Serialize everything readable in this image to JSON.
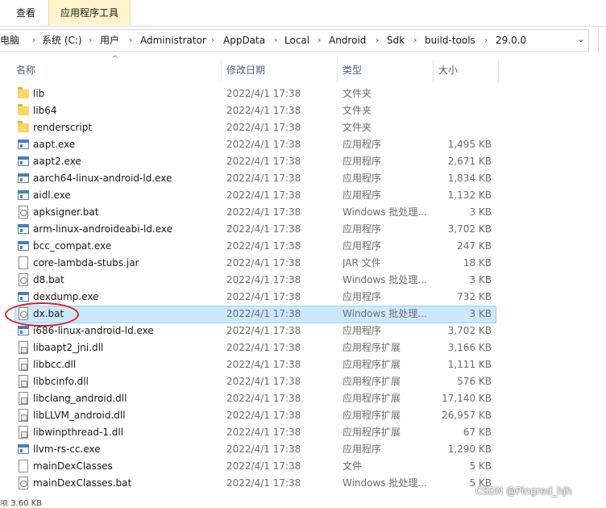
{
  "ribbon": {
    "tabs": [
      {
        "label": "查看"
      },
      {
        "label": "应用程序工具"
      }
    ]
  },
  "address": {
    "crumbs": [
      "电脑",
      "系统 (C:)",
      "用户",
      "Administrator",
      "AppData",
      "Local",
      "Android",
      "Sdk",
      "build-tools",
      "29.0.0"
    ],
    "separator": "›",
    "dropdown_icon": "chevron-down-icon"
  },
  "columns": {
    "name": "名称",
    "date": "修改日期",
    "type": "类型",
    "size": "大小"
  },
  "files": [
    {
      "name": "lib",
      "date": "2022/4/1 17:38",
      "type": "文件夹",
      "size": "",
      "icon": "folder-icon"
    },
    {
      "name": "lib64",
      "date": "2022/4/1 17:38",
      "type": "文件夹",
      "size": "",
      "icon": "folder-icon"
    },
    {
      "name": "renderscript",
      "date": "2022/4/1 17:38",
      "type": "文件夹",
      "size": "",
      "icon": "folder-icon"
    },
    {
      "name": "aapt.exe",
      "date": "2022/4/1 17:38",
      "type": "应用程序",
      "size": "1,495 KB",
      "icon": "exe-icon"
    },
    {
      "name": "aapt2.exe",
      "date": "2022/4/1 17:38",
      "type": "应用程序",
      "size": "2,671 KB",
      "icon": "exe-icon"
    },
    {
      "name": "aarch64-linux-android-ld.exe",
      "date": "2022/4/1 17:38",
      "type": "应用程序",
      "size": "1,834 KB",
      "icon": "exe-icon"
    },
    {
      "name": "aidl.exe",
      "date": "2022/4/1 17:38",
      "type": "应用程序",
      "size": "1,132 KB",
      "icon": "exe-icon"
    },
    {
      "name": "apksigner.bat",
      "date": "2022/4/1 17:38",
      "type": "Windows 批处理...",
      "size": "3 KB",
      "icon": "bat-icon"
    },
    {
      "name": "arm-linux-androideabi-ld.exe",
      "date": "2022/4/1 17:38",
      "type": "应用程序",
      "size": "3,702 KB",
      "icon": "exe-icon"
    },
    {
      "name": "bcc_compat.exe",
      "date": "2022/4/1 17:38",
      "type": "应用程序",
      "size": "247 KB",
      "icon": "exe-icon"
    },
    {
      "name": "core-lambda-stubs.jar",
      "date": "2022/4/1 17:38",
      "type": "JAR 文件",
      "size": "18 KB",
      "icon": "file-icon"
    },
    {
      "name": "d8.bat",
      "date": "2022/4/1 17:38",
      "type": "Windows 批处理...",
      "size": "3 KB",
      "icon": "bat-icon"
    },
    {
      "name": "dexdump.exe",
      "date": "2022/4/1 17:38",
      "type": "应用程序",
      "size": "732 KB",
      "icon": "exe-icon"
    },
    {
      "name": "dx.bat",
      "date": "2022/4/1 17:38",
      "type": "Windows 批处理...",
      "size": "3 KB",
      "icon": "bat-icon",
      "selected": true
    },
    {
      "name": "i686-linux-android-ld.exe",
      "date": "2022/4/1 17:38",
      "type": "应用程序",
      "size": "3,702 KB",
      "icon": "exe-icon"
    },
    {
      "name": "libaapt2_jni.dll",
      "date": "2022/4/1 17:38",
      "type": "应用程序扩展",
      "size": "3,166 KB",
      "icon": "dll-icon"
    },
    {
      "name": "libbcc.dll",
      "date": "2022/4/1 17:38",
      "type": "应用程序扩展",
      "size": "1,111 KB",
      "icon": "dll-icon"
    },
    {
      "name": "libbcinfo.dll",
      "date": "2022/4/1 17:38",
      "type": "应用程序扩展",
      "size": "576 KB",
      "icon": "dll-icon"
    },
    {
      "name": "libclang_android.dll",
      "date": "2022/4/1 17:38",
      "type": "应用程序扩展",
      "size": "17,140 KB",
      "icon": "dll-icon"
    },
    {
      "name": "libLLVM_android.dll",
      "date": "2022/4/1 17:38",
      "type": "应用程序扩展",
      "size": "26,957 KB",
      "icon": "dll-icon"
    },
    {
      "name": "libwinpthread-1.dll",
      "date": "2022/4/1 17:38",
      "type": "应用程序扩展",
      "size": "67 KB",
      "icon": "dll-icon"
    },
    {
      "name": "llvm-rs-cc.exe",
      "date": "2022/4/1 17:38",
      "type": "应用程序",
      "size": "1,290 KB",
      "icon": "exe-icon"
    },
    {
      "name": "mainDexClasses",
      "date": "2022/4/1 17:38",
      "type": "文件",
      "size": "5 KB",
      "icon": "file-icon"
    },
    {
      "name": "mainDexClasses.bat",
      "date": "2022/4/1 17:38",
      "type": "Windows 批处理...",
      "size": "5 KB",
      "icon": "bat-icon"
    }
  ],
  "status": {
    "text": "项 3.60 KB"
  },
  "watermark": "CSDN @Pingred_hjh",
  "colors": {
    "selection_bg": "#cce8ff",
    "selection_border": "#99d1ff",
    "annotation_red": "#d62020",
    "header_text": "#4c607a",
    "app_tools_tab": "#fff4cc"
  }
}
